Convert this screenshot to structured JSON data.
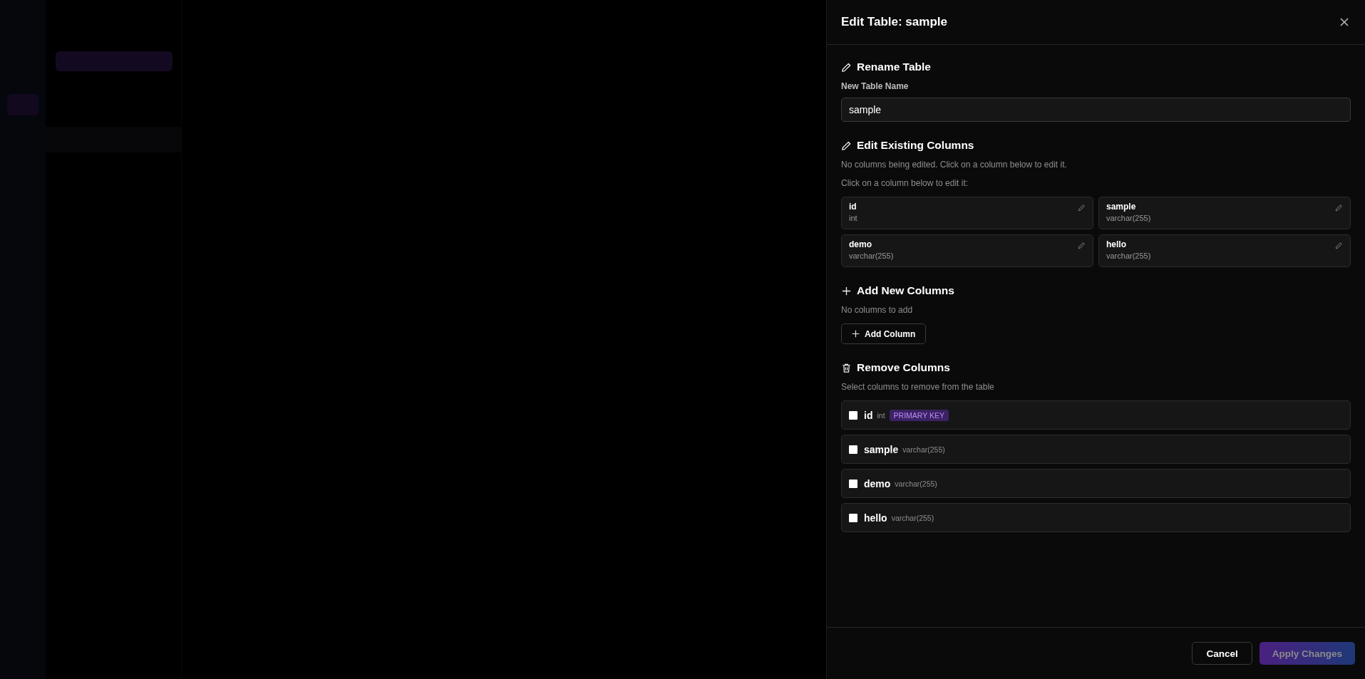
{
  "panel": {
    "title": "Edit Table: sample"
  },
  "rename": {
    "heading": "Rename Table",
    "label": "New Table Name",
    "value": "sample"
  },
  "edit_columns": {
    "heading": "Edit Existing Columns",
    "status": "No columns being edited. Click on a column below to edit it.",
    "hint": "Click on a column below to edit it:",
    "columns": [
      {
        "name": "id",
        "type": "int"
      },
      {
        "name": "sample",
        "type": "varchar(255)"
      },
      {
        "name": "demo",
        "type": "varchar(255)"
      },
      {
        "name": "hello",
        "type": "varchar(255)"
      }
    ]
  },
  "add_columns": {
    "heading": "Add New Columns",
    "status": "No columns to add",
    "button": "Add Column"
  },
  "remove_columns": {
    "heading": "Remove Columns",
    "hint": "Select columns to remove from the table",
    "columns": [
      {
        "name": "id",
        "type": "int",
        "badge": "PRIMARY KEY",
        "checked": false
      },
      {
        "name": "sample",
        "type": "varchar(255)",
        "checked": false
      },
      {
        "name": "demo",
        "type": "varchar(255)",
        "checked": false
      },
      {
        "name": "hello",
        "type": "varchar(255)",
        "checked": false
      }
    ]
  },
  "footer": {
    "cancel": "Cancel",
    "apply": {
      "label": "Apply Changes",
      "disabled": true
    }
  }
}
